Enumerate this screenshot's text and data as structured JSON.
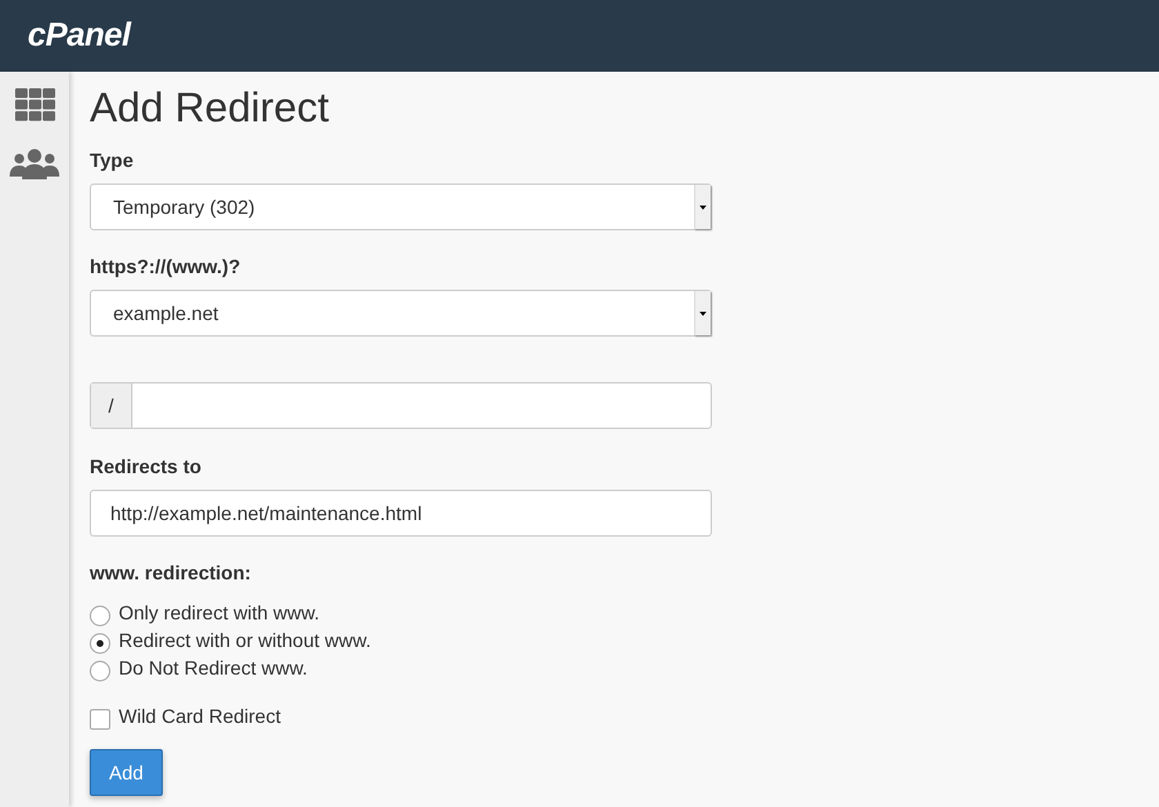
{
  "header": {
    "logo": "cPanel"
  },
  "page_title": "Add Redirect",
  "type_field": {
    "label": "Type",
    "value": "Temporary (302)"
  },
  "domain_field": {
    "label": "https?://(www.)?",
    "value": "example.net"
  },
  "path_field": {
    "prefix": "/"
  },
  "target_field": {
    "label": "Redirects to",
    "value": "http://example.net/maintenance.html"
  },
  "www_redirection": {
    "label": "www. redirection:",
    "options": [
      {
        "label": "Only redirect with www.",
        "selected": false
      },
      {
        "label": "Redirect with or without www.",
        "selected": true
      },
      {
        "label": "Do Not Redirect www.",
        "selected": false
      }
    ]
  },
  "wildcard": {
    "label": "Wild Card Redirect",
    "checked": false
  },
  "submit_button": "Add"
}
